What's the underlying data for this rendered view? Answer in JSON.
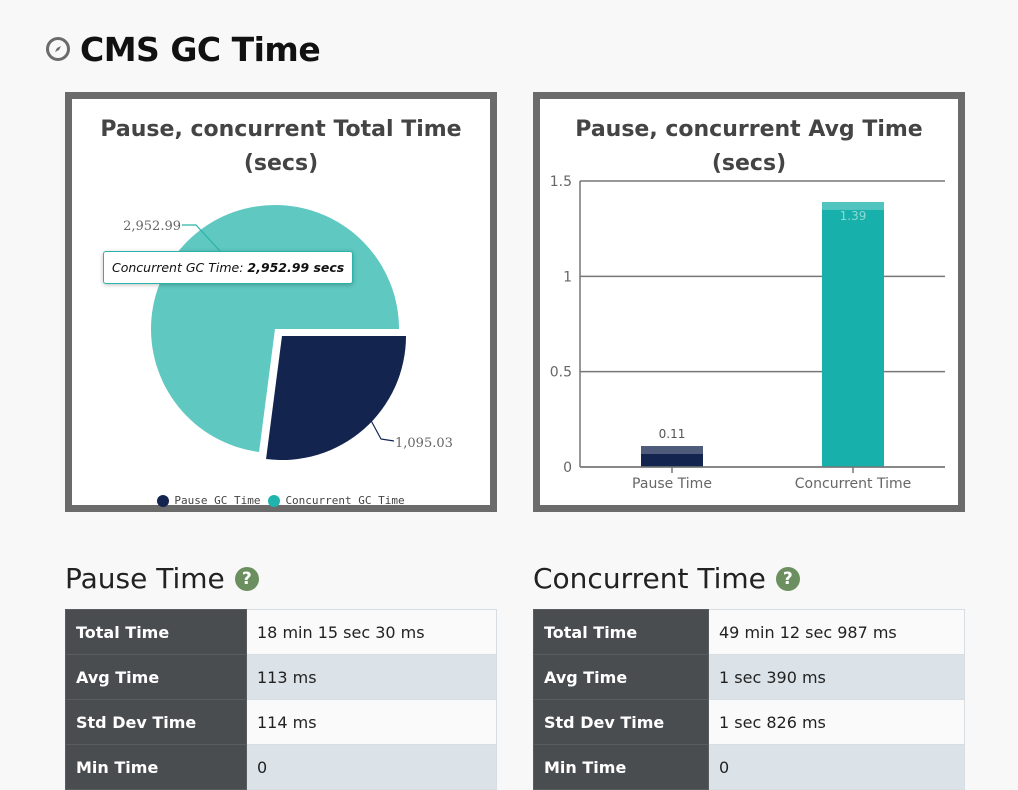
{
  "header": {
    "title": "CMS GC Time",
    "icon": "compass-icon"
  },
  "chart_data": [
    {
      "type": "pie",
      "title": "Pause, concurrent Total Time (secs)",
      "slices": [
        {
          "name": "Pause GC Time",
          "value": 1095.03,
          "label": "1,095.03",
          "color": "#13244f"
        },
        {
          "name": "Concurrent GC Time",
          "value": 2952.99,
          "label": "2,952.99",
          "color": "#5ec8c1"
        }
      ],
      "legend": {
        "position": "bottom",
        "items": [
          "Pause GC Time",
          "Concurrent GC Time"
        ]
      },
      "tooltip": {
        "label": "Concurrent GC Time:",
        "value": "2,952.99 secs"
      }
    },
    {
      "type": "bar",
      "title": "Pause, concurrent Avg Time (secs)",
      "categories": [
        "Pause Time",
        "Concurrent Time"
      ],
      "values": [
        0.11,
        1.39
      ],
      "value_labels": [
        "0.11",
        "1.39"
      ],
      "colors": [
        "#13244f",
        "#17b0aa"
      ],
      "ylim": [
        0,
        1.5
      ],
      "yticks": [
        "0",
        "0.5",
        "1",
        "1.5"
      ],
      "grid": true
    }
  ],
  "pause": {
    "title": "Pause Time",
    "rows": [
      {
        "key": "Total Time",
        "value": "18 min 15 sec 30 ms"
      },
      {
        "key": "Avg Time",
        "value": "113 ms"
      },
      {
        "key": "Std Dev Time",
        "value": "114 ms"
      },
      {
        "key": "Min Time",
        "value": "0"
      }
    ]
  },
  "concurrent": {
    "title": "Concurrent Time",
    "rows": [
      {
        "key": "Total Time",
        "value": "49 min 12 sec 987 ms"
      },
      {
        "key": "Avg Time",
        "value": "1 sec 390 ms"
      },
      {
        "key": "Std Dev Time",
        "value": "1 sec 826 ms"
      },
      {
        "key": "Min Time",
        "value": "0"
      }
    ]
  },
  "help_icon_label": "?",
  "colors": {
    "card_border": "#6b6b6b",
    "key_cell": "#4a4d50",
    "help_icon": "#6b8f5f"
  }
}
